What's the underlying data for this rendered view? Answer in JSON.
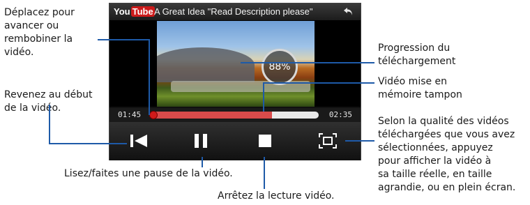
{
  "callouts": {
    "seek": "Déplacez pour\navancer ou\nrembobiner la\nvidéo.",
    "restart": "Revenez au début\nde la vidéo.",
    "download_progress": "Progression du\ntéléchargement",
    "buffered": "Vidéo mise en\nmémoire tampon",
    "size": "Selon la qualité des vidéos\ntéléchargées que vous avez\nsélectionnées, appuyez\npour afficher la vidéo à\nsa taille réelle, en taille\nagrandie, ou en plein écran.",
    "play_pause": "Lisez/faites une pause de la vidéo.",
    "stop": "Arrêtez la lecture vidéo."
  },
  "player": {
    "logo_you": "You",
    "logo_tube": "Tube",
    "title": "A Great Idea \"Read Description please\"",
    "download_percent": "88%",
    "time_elapsed": "01:45",
    "time_total": "02:35",
    "buffered_fraction": 0.72,
    "played_fraction": 0.0
  },
  "colors": {
    "callout_line": "#1e5aa8",
    "youtube_red": "#cc1b1b",
    "seek_fill": "#d94b4b"
  },
  "icons": [
    "back-arrow-icon",
    "skip-to-start-icon",
    "pause-icon",
    "stop-icon",
    "fullscreen-icon"
  ]
}
